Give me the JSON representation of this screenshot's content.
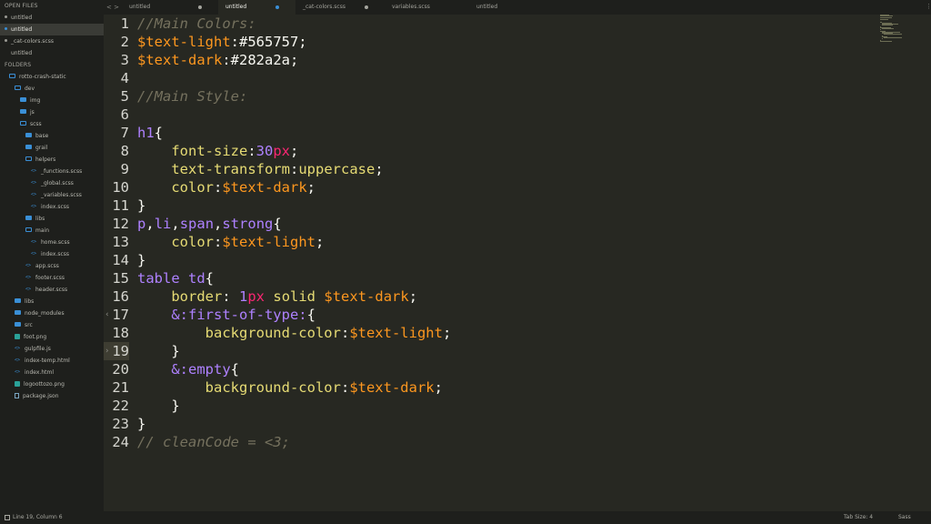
{
  "sidebar": {
    "open_files_label": "OPEN FILES",
    "open_files": [
      {
        "label": "untitled",
        "dot": "gray",
        "selected": false
      },
      {
        "label": "untitled",
        "dot": "blue",
        "selected": true
      },
      {
        "label": "_cat-colors.scss",
        "dot": "gray",
        "selected": false
      },
      {
        "label": "untitled",
        "dot": "none",
        "selected": false
      }
    ],
    "folders_label": "FOLDERS",
    "tree": [
      {
        "label": "rotto-crash-static",
        "indent": 0,
        "icon": "folder-open-icon"
      },
      {
        "label": "dev",
        "indent": 1,
        "icon": "folder-open-icon"
      },
      {
        "label": "img",
        "indent": 2,
        "icon": "folder-icon"
      },
      {
        "label": "js",
        "indent": 2,
        "icon": "folder-icon"
      },
      {
        "label": "scss",
        "indent": 2,
        "icon": "folder-open-icon"
      },
      {
        "label": "base",
        "indent": 3,
        "icon": "folder-icon"
      },
      {
        "label": "grail",
        "indent": 3,
        "icon": "folder-icon"
      },
      {
        "label": "helpers",
        "indent": 3,
        "icon": "folder-open-icon"
      },
      {
        "label": "_functions.scss",
        "indent": 4,
        "icon": "file-code-icon"
      },
      {
        "label": "_global.scss",
        "indent": 4,
        "icon": "file-code-icon"
      },
      {
        "label": "_variables.scss",
        "indent": 4,
        "icon": "file-code-icon"
      },
      {
        "label": "index.scss",
        "indent": 4,
        "icon": "file-code-icon"
      },
      {
        "label": "libs",
        "indent": 3,
        "icon": "folder-icon"
      },
      {
        "label": "main",
        "indent": 3,
        "icon": "folder-open-icon"
      },
      {
        "label": "home.scss",
        "indent": 4,
        "icon": "file-code-icon"
      },
      {
        "label": "index.scss",
        "indent": 4,
        "icon": "file-code-icon"
      },
      {
        "label": "app.scss",
        "indent": 3,
        "icon": "file-code-icon"
      },
      {
        "label": "footer.scss",
        "indent": 3,
        "icon": "file-code-icon"
      },
      {
        "label": "header.scss",
        "indent": 3,
        "icon": "file-code-icon"
      },
      {
        "label": "libs",
        "indent": 1,
        "icon": "folder-icon"
      },
      {
        "label": "node_modules",
        "indent": 1,
        "icon": "folder-icon"
      },
      {
        "label": "src",
        "indent": 1,
        "icon": "folder-icon"
      },
      {
        "label": "foot.png",
        "indent": 1,
        "icon": "file-img-icon"
      },
      {
        "label": "gulpfile.js",
        "indent": 1,
        "icon": "file-code-icon"
      },
      {
        "label": "index-temp.html",
        "indent": 1,
        "icon": "file-code-icon"
      },
      {
        "label": "index.html",
        "indent": 1,
        "icon": "file-code-icon"
      },
      {
        "label": "logoottozo.png",
        "indent": 1,
        "icon": "file-img-icon"
      },
      {
        "label": "package.json",
        "indent": 1,
        "icon": "file-gen-icon"
      }
    ]
  },
  "tabs": {
    "nav": "< >",
    "items": [
      {
        "label": "untitled",
        "active": false,
        "dot": "gray"
      },
      {
        "label": "untitled",
        "active": true,
        "dot": "blue"
      },
      {
        "label": "_cat-colors.scss",
        "active": false,
        "dot": "gray"
      },
      {
        "label": "variables.scss",
        "active": false,
        "dot": "none"
      },
      {
        "label": "untitled",
        "active": false,
        "dot": "none"
      }
    ]
  },
  "editor": {
    "current_line": 19,
    "lines": [
      {
        "n": "1",
        "tokens": [
          {
            "t": "//Main Colors:",
            "c": "t-c"
          }
        ]
      },
      {
        "n": "2",
        "tokens": [
          {
            "t": "$text-light",
            "c": "t-v"
          },
          {
            "t": ":#565757;",
            "c": "t-p"
          }
        ]
      },
      {
        "n": "3",
        "tokens": [
          {
            "t": "$text-dark",
            "c": "t-v"
          },
          {
            "t": ":#282a2a;",
            "c": "t-p"
          }
        ]
      },
      {
        "n": "4",
        "tokens": []
      },
      {
        "n": "5",
        "tokens": [
          {
            "t": "//Main Style:",
            "c": "t-c"
          }
        ]
      },
      {
        "n": "6",
        "tokens": []
      },
      {
        "n": "7",
        "tokens": [
          {
            "t": "h1",
            "c": "t-s"
          },
          {
            "t": "{",
            "c": "t-p"
          }
        ]
      },
      {
        "n": "8",
        "tokens": [
          {
            "t": "    ",
            "c": "t-p"
          },
          {
            "t": "font-size",
            "c": "t-k"
          },
          {
            "t": ":",
            "c": "t-p"
          },
          {
            "t": "30",
            "c": "t-n"
          },
          {
            "t": "px",
            "c": "t-u"
          },
          {
            "t": ";",
            "c": "t-p"
          }
        ]
      },
      {
        "n": "9",
        "tokens": [
          {
            "t": "    ",
            "c": "t-p"
          },
          {
            "t": "text-transform",
            "c": "t-k"
          },
          {
            "t": ":",
            "c": "t-p"
          },
          {
            "t": "uppercase",
            "c": "t-k"
          },
          {
            "t": ";",
            "c": "t-p"
          }
        ]
      },
      {
        "n": "10",
        "tokens": [
          {
            "t": "    ",
            "c": "t-p"
          },
          {
            "t": "color",
            "c": "t-k"
          },
          {
            "t": ":",
            "c": "t-p"
          },
          {
            "t": "$text-dark",
            "c": "t-v"
          },
          {
            "t": ";",
            "c": "t-p"
          }
        ]
      },
      {
        "n": "11",
        "tokens": [
          {
            "t": "}",
            "c": "t-p"
          }
        ]
      },
      {
        "n": "12",
        "tokens": [
          {
            "t": "p",
            "c": "t-s"
          },
          {
            "t": ",",
            "c": "t-p"
          },
          {
            "t": "li",
            "c": "t-s"
          },
          {
            "t": ",",
            "c": "t-p"
          },
          {
            "t": "span",
            "c": "t-s"
          },
          {
            "t": ",",
            "c": "t-p"
          },
          {
            "t": "strong",
            "c": "t-s"
          },
          {
            "t": "{",
            "c": "t-p"
          }
        ]
      },
      {
        "n": "13",
        "tokens": [
          {
            "t": "    ",
            "c": "t-p"
          },
          {
            "t": "color",
            "c": "t-k"
          },
          {
            "t": ":",
            "c": "t-p"
          },
          {
            "t": "$text-light",
            "c": "t-v"
          },
          {
            "t": ";",
            "c": "t-p"
          }
        ]
      },
      {
        "n": "14",
        "tokens": [
          {
            "t": "}",
            "c": "t-p"
          }
        ]
      },
      {
        "n": "15",
        "tokens": [
          {
            "t": "table td",
            "c": "t-s"
          },
          {
            "t": "{",
            "c": "t-p"
          }
        ]
      },
      {
        "n": "16",
        "tokens": [
          {
            "t": "    ",
            "c": "t-p"
          },
          {
            "t": "border",
            "c": "t-k"
          },
          {
            "t": ": ",
            "c": "t-p"
          },
          {
            "t": "1",
            "c": "t-n"
          },
          {
            "t": "px",
            "c": "t-u"
          },
          {
            "t": " ",
            "c": "t-p"
          },
          {
            "t": "solid",
            "c": "t-k"
          },
          {
            "t": " ",
            "c": "t-p"
          },
          {
            "t": "$text-dark",
            "c": "t-v"
          },
          {
            "t": ";",
            "c": "t-p"
          }
        ]
      },
      {
        "n": "17",
        "fold": true,
        "tokens": [
          {
            "t": "    ",
            "c": "t-p"
          },
          {
            "t": "&:first-of-type:",
            "c": "t-s"
          },
          {
            "t": "{",
            "c": "t-p"
          }
        ]
      },
      {
        "n": "18",
        "tokens": [
          {
            "t": "        ",
            "c": "t-p"
          },
          {
            "t": "background-color",
            "c": "t-k"
          },
          {
            "t": ":",
            "c": "t-p"
          },
          {
            "t": "$text-light",
            "c": "t-v"
          },
          {
            "t": ";",
            "c": "t-p"
          }
        ]
      },
      {
        "n": "19",
        "fold": true,
        "tokens": [
          {
            "t": "    ",
            "c": "t-p"
          },
          {
            "t": "}",
            "c": "t-p"
          }
        ]
      },
      {
        "n": "20",
        "tokens": [
          {
            "t": "    ",
            "c": "t-p"
          },
          {
            "t": "&:empty",
            "c": "t-s"
          },
          {
            "t": "{",
            "c": "t-p"
          }
        ]
      },
      {
        "n": "21",
        "tokens": [
          {
            "t": "        ",
            "c": "t-p"
          },
          {
            "t": "background-color",
            "c": "t-k"
          },
          {
            "t": ":",
            "c": "t-p"
          },
          {
            "t": "$text-dark",
            "c": "t-v"
          },
          {
            "t": ";",
            "c": "t-p"
          }
        ]
      },
      {
        "n": "22",
        "tokens": [
          {
            "t": "    ",
            "c": "t-p"
          },
          {
            "t": "}",
            "c": "t-p"
          }
        ]
      },
      {
        "n": "23",
        "tokens": [
          {
            "t": "}",
            "c": "t-p"
          }
        ]
      },
      {
        "n": "24",
        "tokens": [
          {
            "t": "// cleanCode = <3;",
            "c": "t-c"
          }
        ]
      }
    ]
  },
  "status": {
    "position": "Line 19, Column 6",
    "tab_size": "Tab Size: 4",
    "syntax": "Sass"
  }
}
